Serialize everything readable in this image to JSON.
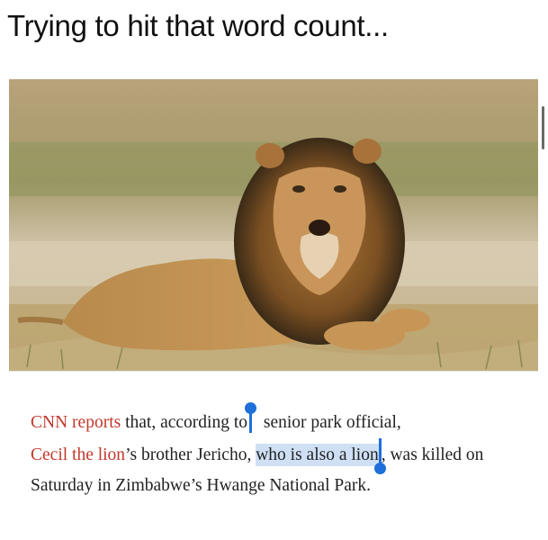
{
  "caption": "Trying to hit that word count...",
  "article": {
    "link1": "CNN reports",
    "text1": " that, according to",
    "text2": " senior park official,",
    "link2": "Cecil the lion",
    "text3": "’s brother Jericho, ",
    "selected": "who is also a lion",
    "text4": ", was killed on Saturday in Zimbabwe’s Hwange National Park."
  },
  "colors": {
    "link": "#c0392b",
    "selection": "#cfe0f5",
    "handle": "#1e6fd9"
  }
}
